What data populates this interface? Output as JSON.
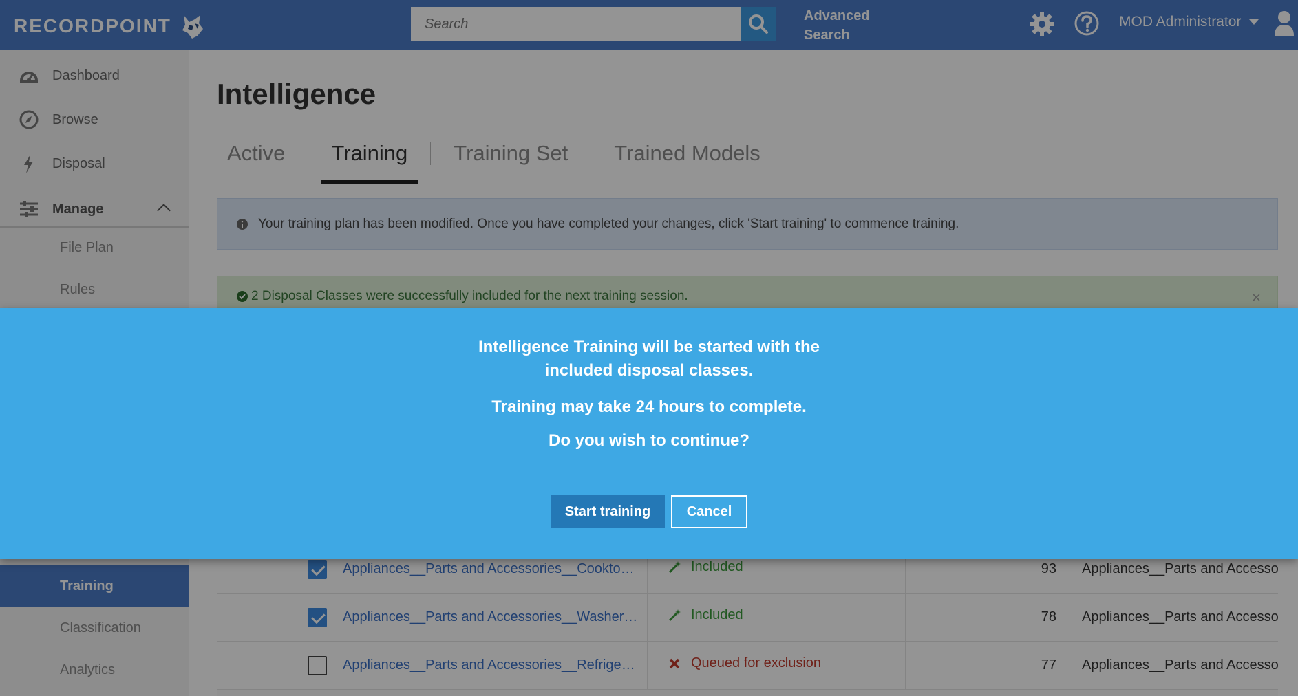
{
  "header": {
    "logo_text": "RECORDPOINT",
    "search_placeholder": "Search",
    "advanced_search_line1": "Advanced",
    "advanced_search_line2": "Search",
    "user_name": "MOD Administrator"
  },
  "sidebar": {
    "items": [
      {
        "label": "Dashboard",
        "icon": "dashboard-icon"
      },
      {
        "label": "Browse",
        "icon": "compass-icon"
      },
      {
        "label": "Disposal",
        "icon": "lightning-icon"
      },
      {
        "label": "Manage",
        "icon": "sliders-icon"
      }
    ],
    "sub_items": [
      {
        "label": "File Plan"
      },
      {
        "label": "Rules"
      },
      {
        "label": "Training"
      },
      {
        "label": "Classification"
      },
      {
        "label": "Analytics"
      }
    ]
  },
  "main": {
    "title": "Intelligence",
    "tabs": [
      "Active",
      "Training",
      "Training Set",
      "Trained Models"
    ],
    "active_tab": "Training",
    "info_message": "Your training plan has been modified. Once you have completed your changes, click 'Start training' to commence training.",
    "success_message": "2 Disposal Classes were successfully included for the next training session.",
    "close_glyph": "×",
    "rows": [
      {
        "name": "Appliances__Parts and Accessories__Cooktop Parts",
        "status": "Included",
        "count": "93",
        "path": "Appliances__Parts and Accessories_",
        "checked": true
      },
      {
        "name": "Appliances__Parts and Accessories__Washer Parts",
        "status": "Included",
        "count": "78",
        "path": "Appliances__Parts and Accessories_",
        "checked": true
      },
      {
        "name": "Appliances__Parts and Accessories__Refrigerator Parts",
        "status": "Queued for exclusion",
        "count": "77",
        "path": "Appliances__Parts and Accessories_",
        "checked": false
      }
    ]
  },
  "modal": {
    "line1": "Intelligence Training will be started with the",
    "line2": "included disposal classes.",
    "line3": "Training may take 24 hours to complete.",
    "line4": "Do you wish to continue?",
    "start_label": "Start training",
    "cancel_label": "Cancel"
  },
  "colors": {
    "header_bg": "#4a7ac7",
    "modal_bg": "#3ea8e4",
    "start_button": "#2478b6",
    "included": "#3c9a3c",
    "excluded": "#c0392b"
  }
}
